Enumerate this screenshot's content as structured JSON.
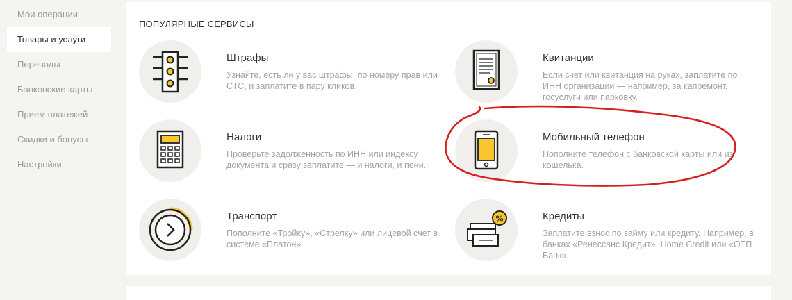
{
  "sidebar": {
    "items": [
      {
        "label": "Мои операции"
      },
      {
        "label": "Товары и услуги"
      },
      {
        "label": "Переводы"
      },
      {
        "label": "Банковские карты"
      },
      {
        "label": "Прием платежей"
      },
      {
        "label": "Скидки и бонусы"
      },
      {
        "label": "Настройки"
      }
    ]
  },
  "main": {
    "section_title": "ПОПУЛЯРНЫЕ СЕРВИСЫ",
    "services": [
      {
        "name": "Штрафы",
        "desc": "Узнайте, есть ли у вас штрафы, по номеру прав или СТС, и заплатите в пару кликов.",
        "icon": "traffic-light-icon"
      },
      {
        "name": "Квитанции",
        "desc": "Если счет или квитанция на руках, заплатите по ИНН организации — например, за капремонт, госуслуги или парковку.",
        "icon": "receipt-icon"
      },
      {
        "name": "Налоги",
        "desc": "Проверьте задолженность по ИНН или индексу документа и сразу заплатите — и налоги, и пени.",
        "icon": "calculator-icon"
      },
      {
        "name": "Мобильный телефон",
        "desc": "Пополните телефон с банковской карты или из кошелька.",
        "icon": "mobile-phone-icon"
      },
      {
        "name": "Транспорт",
        "desc": "Пополните «Тройку», «Стрелку» или лицевой счет в системе «Платон»",
        "icon": "transport-card-icon"
      },
      {
        "name": "Кредиты",
        "desc": "Заплатите взнос по займу или кредиту. Например, в банках «Ренессанс Кредит», Home Credit или «ОТП Банк».",
        "icon": "credit-percent-icon"
      }
    ]
  },
  "colors": {
    "accent": "#f9c72d",
    "highlight": "#d62020",
    "icon_bg": "#f0efec",
    "muted_text": "#a3a3a3"
  }
}
